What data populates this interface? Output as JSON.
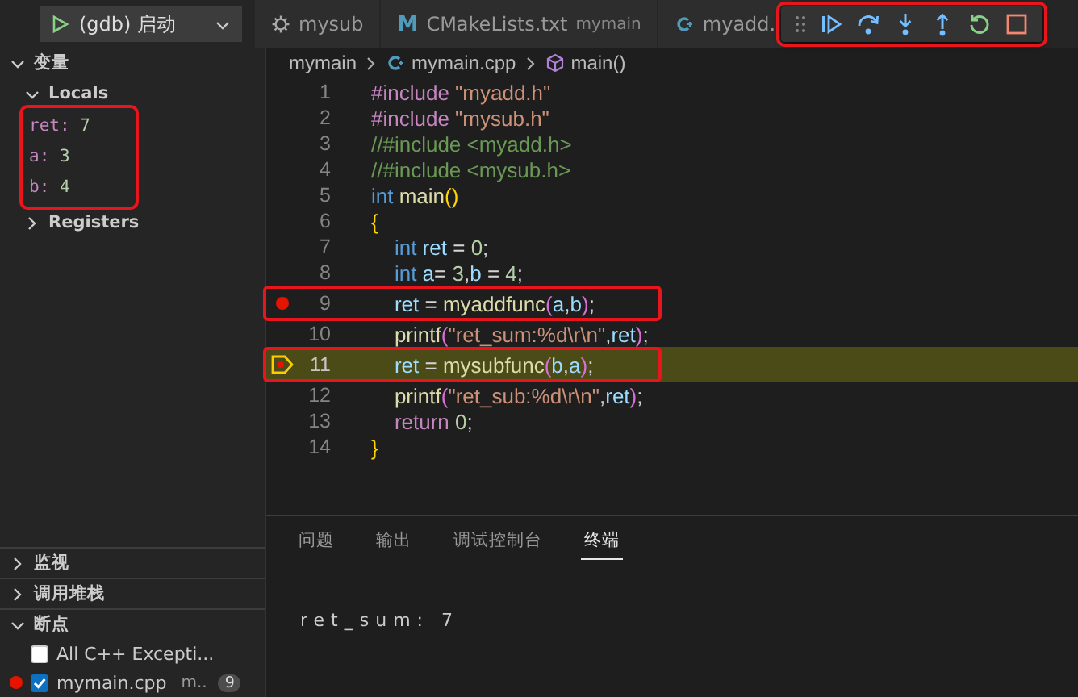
{
  "debug_config": {
    "name": "(gdb) 启动"
  },
  "tabs": [
    {
      "kind": "settings",
      "label": "mysub",
      "selected": false
    },
    {
      "kind": "cmake",
      "icon": "M",
      "label": "CMakeLists.txt",
      "description": "mymain",
      "selected": false
    },
    {
      "kind": "cpp",
      "label": "myadd.",
      "selected": false
    }
  ],
  "debug_toolbar": {
    "annotated": true,
    "buttons": [
      {
        "kind": "continue"
      },
      {
        "kind": "step_over"
      },
      {
        "kind": "step_into"
      },
      {
        "kind": "step_out"
      },
      {
        "kind": "restart"
      },
      {
        "kind": "stop"
      }
    ]
  },
  "sidebar": {
    "sections": [
      {
        "title": "变量",
        "expanded": true,
        "groups": [
          {
            "label": "Locals",
            "expanded": true,
            "annotated": true,
            "variables": [
              {
                "name": "ret:",
                "value": "7"
              },
              {
                "name": "a:",
                "value": "3"
              },
              {
                "name": "b:",
                "value": "4"
              }
            ]
          },
          {
            "label": "Registers",
            "expanded": false
          }
        ]
      },
      {
        "title": "监视",
        "expanded": false
      },
      {
        "title": "调用堆栈",
        "expanded": false
      },
      {
        "title": "断点",
        "expanded": true,
        "breakpoints": [
          {
            "label": "All C++ Excepti...",
            "checked": false,
            "dot": false
          },
          {
            "label": "mymain.cpp",
            "checked": true,
            "dot": true,
            "detail": "m..",
            "line": "9"
          }
        ]
      }
    ]
  },
  "editor": {
    "breadcrumb": [
      {
        "kind": "folder",
        "label": "mymain"
      },
      {
        "kind": "file",
        "label": "mymain.cpp"
      },
      {
        "kind": "symbol",
        "label": "main()"
      }
    ],
    "lines": [
      {
        "number": "1",
        "breakpoint": false,
        "current": false,
        "annotated": false,
        "tokens": [
          {
            "text": "#include ",
            "kind": "pre"
          },
          {
            "text": "\"myadd.h\"",
            "kind": "str"
          }
        ]
      },
      {
        "number": "2",
        "breakpoint": false,
        "current": false,
        "annotated": false,
        "tokens": [
          {
            "text": "#include ",
            "kind": "pre"
          },
          {
            "text": "\"mysub.h\"",
            "kind": "str"
          }
        ]
      },
      {
        "number": "3",
        "breakpoint": false,
        "current": false,
        "annotated": false,
        "tokens": [
          {
            "text": "//#include <myadd.h>",
            "kind": "cmt"
          }
        ]
      },
      {
        "number": "4",
        "breakpoint": false,
        "current": false,
        "annotated": false,
        "tokens": [
          {
            "text": "//#include <mysub.h>",
            "kind": "cmt"
          }
        ]
      },
      {
        "number": "5",
        "breakpoint": false,
        "current": false,
        "annotated": false,
        "tokens": [
          {
            "text": "int",
            "kind": "kw"
          },
          {
            "text": " main",
            "kind": "fn"
          },
          {
            "text": "()",
            "kind": "p1"
          }
        ]
      },
      {
        "number": "6",
        "breakpoint": false,
        "current": false,
        "annotated": false,
        "tokens": [
          {
            "text": "{",
            "kind": "p1"
          }
        ]
      },
      {
        "number": "7",
        "breakpoint": false,
        "current": false,
        "annotated": false,
        "tokens": [
          {
            "text": "    int",
            "kind": "kw"
          },
          {
            "text": " ret",
            "kind": "var"
          },
          {
            "text": " = ",
            "kind": "plain"
          },
          {
            "text": "0",
            "kind": "num"
          },
          {
            "text": ";",
            "kind": "plain"
          }
        ]
      },
      {
        "number": "8",
        "breakpoint": false,
        "current": false,
        "annotated": false,
        "tokens": [
          {
            "text": "    int",
            "kind": "kw"
          },
          {
            "text": " a",
            "kind": "var"
          },
          {
            "text": "= ",
            "kind": "plain"
          },
          {
            "text": "3",
            "kind": "num"
          },
          {
            "text": ",",
            "kind": "plain"
          },
          {
            "text": "b",
            "kind": "var"
          },
          {
            "text": " = ",
            "kind": "plain"
          },
          {
            "text": "4",
            "kind": "num"
          },
          {
            "text": ";",
            "kind": "plain"
          }
        ]
      },
      {
        "number": "9",
        "breakpoint": true,
        "current": false,
        "annotated": true,
        "tokens": [
          {
            "text": "    ret",
            "kind": "var"
          },
          {
            "text": " = ",
            "kind": "plain"
          },
          {
            "text": "myaddfunc",
            "kind": "fn"
          },
          {
            "text": "(",
            "kind": "p2"
          },
          {
            "text": "a",
            "kind": "var"
          },
          {
            "text": ",",
            "kind": "plain"
          },
          {
            "text": "b",
            "kind": "var"
          },
          {
            "text": ")",
            "kind": "p2"
          },
          {
            "text": ";",
            "kind": "plain"
          }
        ]
      },
      {
        "number": "10",
        "breakpoint": false,
        "current": false,
        "annotated": false,
        "tokens": [
          {
            "text": "    printf",
            "kind": "fn"
          },
          {
            "text": "(",
            "kind": "p2"
          },
          {
            "text": "\"ret_sum:%d\\r\\n\"",
            "kind": "str"
          },
          {
            "text": ",",
            "kind": "plain"
          },
          {
            "text": "ret",
            "kind": "var"
          },
          {
            "text": ")",
            "kind": "p2"
          },
          {
            "text": ";",
            "kind": "plain"
          }
        ]
      },
      {
        "number": "11",
        "breakpoint": false,
        "current": true,
        "annotated": true,
        "tokens": [
          {
            "text": "    ret",
            "kind": "var"
          },
          {
            "text": " = ",
            "kind": "plain"
          },
          {
            "text": "mysubfunc",
            "kind": "fn"
          },
          {
            "text": "(",
            "kind": "p2"
          },
          {
            "text": "b",
            "kind": "var"
          },
          {
            "text": ",",
            "kind": "plain"
          },
          {
            "text": "a",
            "kind": "var"
          },
          {
            "text": ")",
            "kind": "p2"
          },
          {
            "text": ";",
            "kind": "plain"
          }
        ]
      },
      {
        "number": "12",
        "breakpoint": false,
        "current": false,
        "annotated": false,
        "tokens": [
          {
            "text": "    printf",
            "kind": "fn"
          },
          {
            "text": "(",
            "kind": "p2"
          },
          {
            "text": "\"ret_sub:%d\\r\\n\"",
            "kind": "str"
          },
          {
            "text": ",",
            "kind": "plain"
          },
          {
            "text": "ret",
            "kind": "var"
          },
          {
            "text": ")",
            "kind": "p2"
          },
          {
            "text": ";",
            "kind": "plain"
          }
        ]
      },
      {
        "number": "13",
        "breakpoint": false,
        "current": false,
        "annotated": false,
        "tokens": [
          {
            "text": "    return",
            "kind": "pre"
          },
          {
            "text": " 0",
            "kind": "num"
          },
          {
            "text": ";",
            "kind": "plain"
          }
        ]
      },
      {
        "number": "14",
        "breakpoint": false,
        "current": false,
        "annotated": false,
        "tokens": [
          {
            "text": "}",
            "kind": "p1"
          }
        ]
      }
    ]
  },
  "panel": {
    "tabs": [
      {
        "label": "问题",
        "selected": false
      },
      {
        "label": "输出",
        "selected": false
      },
      {
        "label": "调试控制台",
        "selected": false
      },
      {
        "label": "终端",
        "selected": true
      }
    ],
    "terminal": {
      "output": "ret_sum: 7"
    }
  }
}
